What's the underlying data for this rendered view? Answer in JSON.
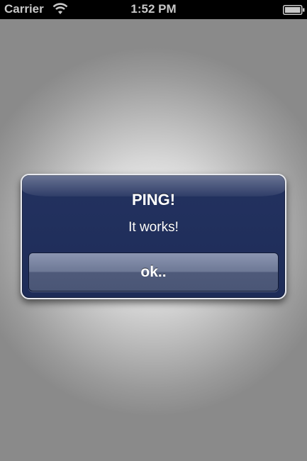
{
  "status_bar": {
    "carrier": "Carrier",
    "time": "1:52 PM",
    "icons": [
      "wifi-icon",
      "battery-icon"
    ]
  },
  "alert": {
    "title": "PING!",
    "message": "It works!",
    "button_label": "ok..",
    "colors": {
      "background": "#1f2d59",
      "border": "#e7e9ef",
      "button": "#6d7895"
    }
  }
}
